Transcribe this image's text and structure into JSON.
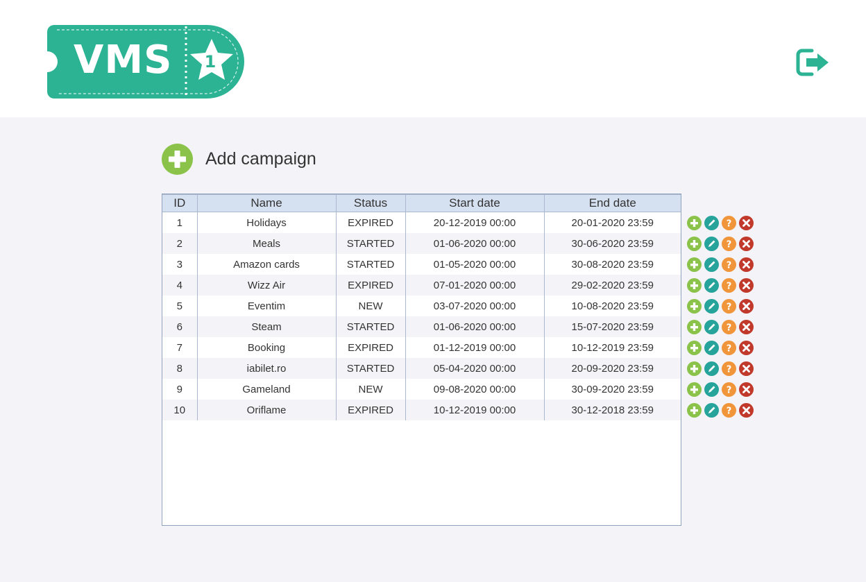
{
  "app": {
    "logo_text": "VMS",
    "logo_badge": "1",
    "brand_color": "#2bb394"
  },
  "header": {
    "logout_icon": "logout-icon"
  },
  "main": {
    "add_campaign_label": "Add campaign",
    "add_icon": "plus-circle-icon"
  },
  "table": {
    "columns": [
      "ID",
      "Name",
      "Status",
      "Start date",
      "End date"
    ],
    "rows": [
      {
        "id": "1",
        "name": "Holidays",
        "status": "EXPIRED",
        "start": "20-12-2019 00:00",
        "end": "20-01-2020 23:59"
      },
      {
        "id": "2",
        "name": "Meals",
        "status": "STARTED",
        "start": "01-06-2020 00:00",
        "end": "30-06-2020 23:59"
      },
      {
        "id": "3",
        "name": "Amazon cards",
        "status": "STARTED",
        "start": "01-05-2020 00:00",
        "end": "30-08-2020 23:59"
      },
      {
        "id": "4",
        "name": "Wizz Air",
        "status": "EXPIRED",
        "start": "07-01-2020 00:00",
        "end": "29-02-2020 23:59"
      },
      {
        "id": "5",
        "name": "Eventim",
        "status": "NEW",
        "start": "03-07-2020 00:00",
        "end": "10-08-2020 23:59"
      },
      {
        "id": "6",
        "name": "Steam",
        "status": "STARTED",
        "start": "01-06-2020 00:00",
        "end": "15-07-2020 23:59"
      },
      {
        "id": "7",
        "name": "Booking",
        "status": "EXPIRED",
        "start": "01-12-2019 00:00",
        "end": "10-12-2019 23:59"
      },
      {
        "id": "8",
        "name": "iabilet.ro",
        "status": "STARTED",
        "start": "05-04-2020 00:00",
        "end": "20-09-2020 23:59"
      },
      {
        "id": "9",
        "name": "Gameland",
        "status": "NEW",
        "start": "09-08-2020 00:00",
        "end": "30-09-2020 23:59"
      },
      {
        "id": "10",
        "name": "Oriflame",
        "status": "EXPIRED",
        "start": "10-12-2019 00:00",
        "end": "30-12-2018 23:59"
      }
    ]
  },
  "row_actions": [
    {
      "name": "add",
      "icon": "plus-icon",
      "color": "#8bc34a"
    },
    {
      "name": "edit",
      "icon": "pencil-icon",
      "color": "#26a39a"
    },
    {
      "name": "help",
      "icon": "question-icon",
      "color": "#f0953a"
    },
    {
      "name": "delete",
      "icon": "x-icon",
      "color": "#c0392b"
    }
  ]
}
